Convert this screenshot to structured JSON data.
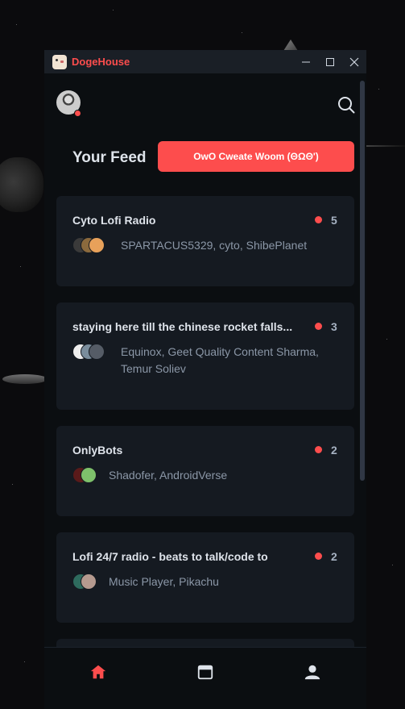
{
  "app": {
    "title": "DogeHouse"
  },
  "window_controls": {
    "minimize_icon": "minimize-icon",
    "maximize_icon": "maximize-icon",
    "close_icon": "close-icon"
  },
  "header": {
    "avatar_status": "online-red-dot",
    "search_icon": "search-icon"
  },
  "feed": {
    "title": "Your Feed",
    "create_button": "OwO Cweate Woom (ΘΩΘ')"
  },
  "rooms": [
    {
      "title": "Cyto Lofi Radio",
      "count": "5",
      "speakers": "SPARTACUS5329, cyto, ShibePlanet"
    },
    {
      "title": "staying here till the chinese rocket falls...",
      "count": "3",
      "speakers_line1": "Equinox, Geet Quality Content Sharma,",
      "speakers_line2": "Temur Soliev"
    },
    {
      "title": "OnlyBots",
      "count": "2",
      "speakers": "Shadofer, AndroidVerse"
    },
    {
      "title": "Lofi 24/7 radio - beats to talk/code to",
      "count": "2",
      "speakers": "Music Player, Pikachu"
    }
  ],
  "nav": {
    "home_icon": "home-icon",
    "calendar_icon": "calendar-icon",
    "profile_icon": "profile-icon"
  },
  "colors": {
    "accent": "#fd4d4d",
    "background": "#0b0e11",
    "card": "#151a21",
    "text": "#dee3ea",
    "muted": "#8b97a7"
  }
}
